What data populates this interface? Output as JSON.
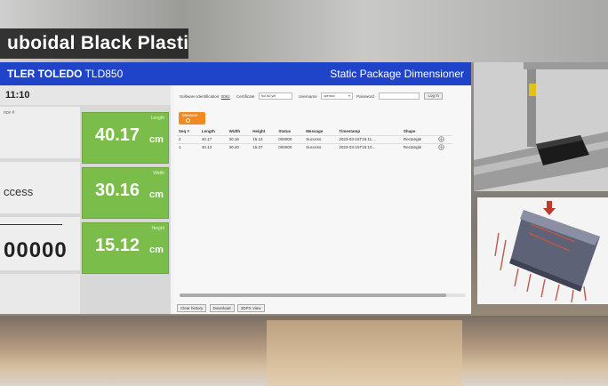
{
  "banner": {
    "title": "uboidal Black Plastic Box"
  },
  "header": {
    "brand": "TLER TOLEDO",
    "model": "TLD850",
    "app_title": "Static Package Dimensioner"
  },
  "left": {
    "clock": "11:10",
    "cells": [
      {
        "label": "nce #",
        "value": ""
      },
      {
        "label": "",
        "value": "ccess"
      },
      {
        "label": "",
        "value": "00000"
      }
    ],
    "measurements": [
      {
        "label": "Length",
        "value": "40.17",
        "unit": "cm"
      },
      {
        "label": "Width",
        "value": "30.16",
        "unit": "cm"
      },
      {
        "label": "Height",
        "value": "15.12",
        "unit": "cm"
      }
    ]
  },
  "toolbar": {
    "software_label": "Software Identification:",
    "software_value": "0061",
    "certificate_label": "Certificate",
    "certificate_value": "Not lsd yet",
    "username_label": "Username",
    "username_value": "operator",
    "password_label": "Password",
    "login_label": "Log In"
  },
  "measure_button": {
    "label": "Measure"
  },
  "table": {
    "headers": [
      "Seq #",
      "Length",
      "Width",
      "Height",
      "Status",
      "Message",
      "Timestamp",
      "Shape",
      ""
    ],
    "rows": [
      [
        "2",
        "40.17",
        "30.16",
        "15.12",
        "000000",
        "Success",
        "2023-03-15T15:11...",
        "Rectangle"
      ],
      [
        "1",
        "40.13",
        "30.20",
        "15.07",
        "000000",
        "Success",
        "2023-03-15T15:10...",
        "Rectangle"
      ]
    ]
  },
  "footer_buttons": [
    "Clear history",
    "Download",
    "3DPX View"
  ],
  "colors": {
    "header_blue": "#1f43c9",
    "measure_green": "#7abd4a",
    "measure_orange": "#f08a24"
  }
}
